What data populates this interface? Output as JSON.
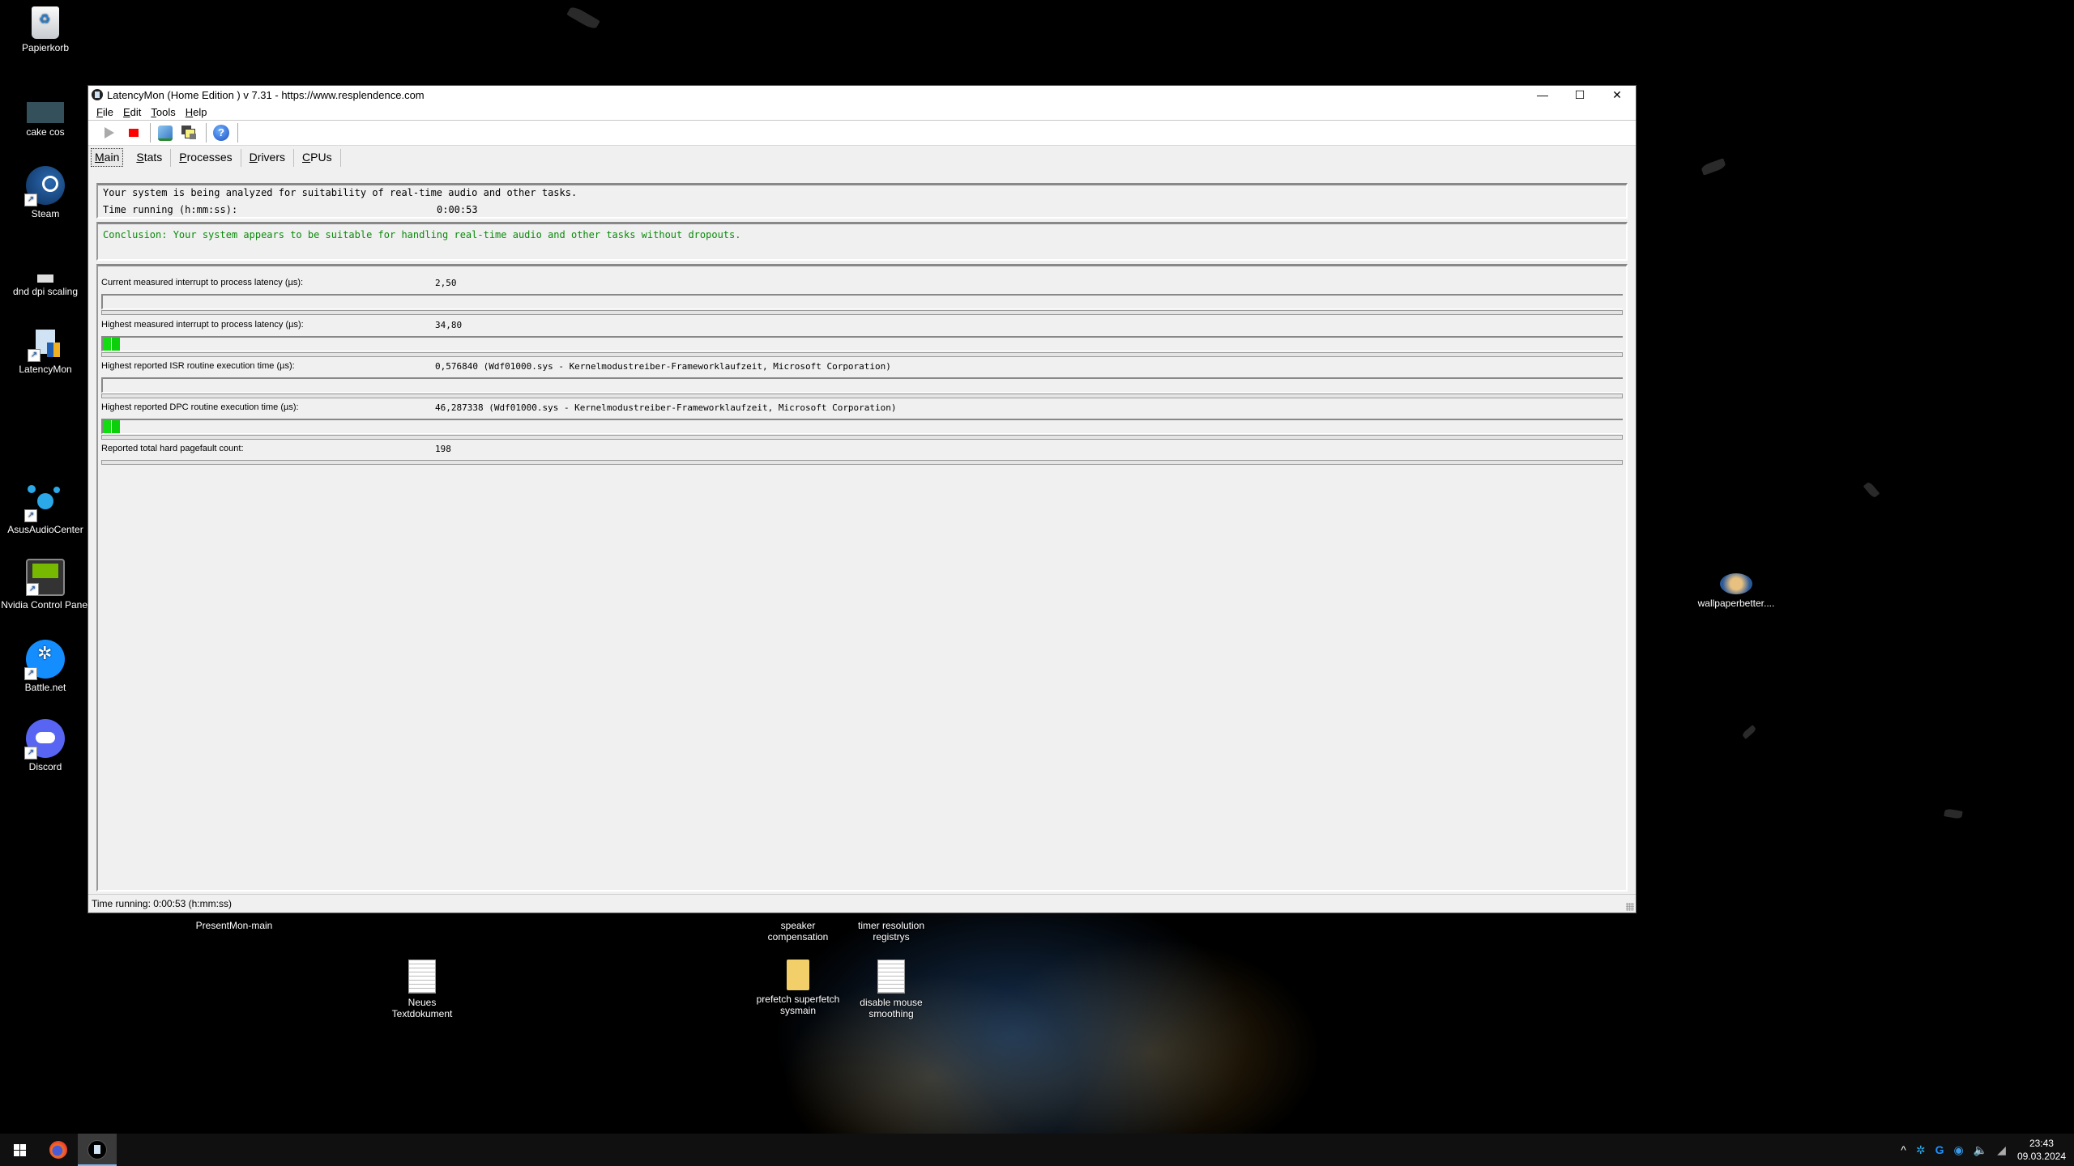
{
  "desktop": {
    "icons_left": [
      {
        "label": "Papierkorb",
        "icon": "recycle-bin-icon"
      },
      {
        "label": "cake cos",
        "icon": "image-thumbnail-icon"
      },
      {
        "label": "Steam",
        "icon": "steam-icon"
      },
      {
        "label": "dnd dpi scaling",
        "icon": "image-thumbnail-icon"
      },
      {
        "label": "LatencyMon",
        "icon": "latencymon-icon"
      },
      {
        "label": "AsusAudioCenter",
        "icon": "asus-audio-icon"
      },
      {
        "label": "Nvidia Control Panel",
        "icon": "nvidia-icon"
      },
      {
        "label": "Battle.net",
        "icon": "battlenet-icon"
      },
      {
        "label": "Discord",
        "icon": "discord-icon"
      }
    ],
    "icons_bottom": [
      {
        "label": "PresentMon-main",
        "icon": "folder-icon"
      },
      {
        "label": "Neues Textdokument",
        "icon": "text-file-icon"
      },
      {
        "label": "speaker compensation",
        "icon": "folder-icon"
      },
      {
        "label": "timer resolution registrys",
        "icon": "folder-icon"
      },
      {
        "label": "prefetch superfetch sysmain",
        "icon": "folder-icon"
      },
      {
        "label": "disable mouse smoothing",
        "icon": "text-file-icon"
      }
    ],
    "icon_right": {
      "label": "wallpaperbetter....",
      "icon": "image-thumbnail-icon"
    }
  },
  "window": {
    "title": "LatencyMon  (Home Edition )  v 7.31 - https://www.resplendence.com",
    "menu": [
      "File",
      "Edit",
      "Tools",
      "Help"
    ],
    "toolbar": [
      "play-icon",
      "stop-icon",
      "report-icon",
      "windows-icon",
      "help-icon"
    ],
    "tabs": [
      "Main",
      "Stats",
      "Processes",
      "Drivers",
      "CPUs"
    ],
    "active_tab": "Main",
    "main": {
      "analysis_text": "Your system is being analyzed for suitability of real-time audio and other tasks.",
      "time_label": "Time running (h:mm:ss):",
      "time_value": "0:00:53",
      "conclusion": "Conclusion: Your system appears to be suitable for handling real-time audio and other tasks without dropouts.",
      "conclusion_color": "#0a8a0a",
      "metrics": [
        {
          "label": "Current measured interrupt to process latency (µs):",
          "value": "2,50",
          "gauge_segments": 0
        },
        {
          "label": "Highest measured interrupt to process latency (µs):",
          "value": "34,80",
          "gauge_segments": 2
        },
        {
          "label": "Highest reported ISR routine execution time (µs):",
          "value": "0,576840  (Wdf01000.sys - Kernelmodustreiber-Frameworklaufzeit, Microsoft Corporation)",
          "gauge_segments": 0
        },
        {
          "label": "Highest reported DPC routine execution time (µs):",
          "value": "46,287338  (Wdf01000.sys - Kernelmodustreiber-Frameworklaufzeit, Microsoft Corporation)",
          "gauge_segments": 2
        },
        {
          "label": "Reported total hard pagefault count:",
          "value": "198",
          "gauge_segments": null
        }
      ]
    },
    "status_bar": "Time running: 0:00:53  (h:mm:ss)"
  },
  "taskbar": {
    "apps": [
      "windows-start-icon",
      "firefox-icon",
      "latencymon-icon"
    ],
    "tray_icons": [
      "chevron-up-icon",
      "asus-audio-tray-icon",
      "logitech-g-icon",
      "steelseries-icon",
      "volume-icon",
      "network-icon"
    ],
    "time": "23:43",
    "date": "09.03.2024"
  }
}
